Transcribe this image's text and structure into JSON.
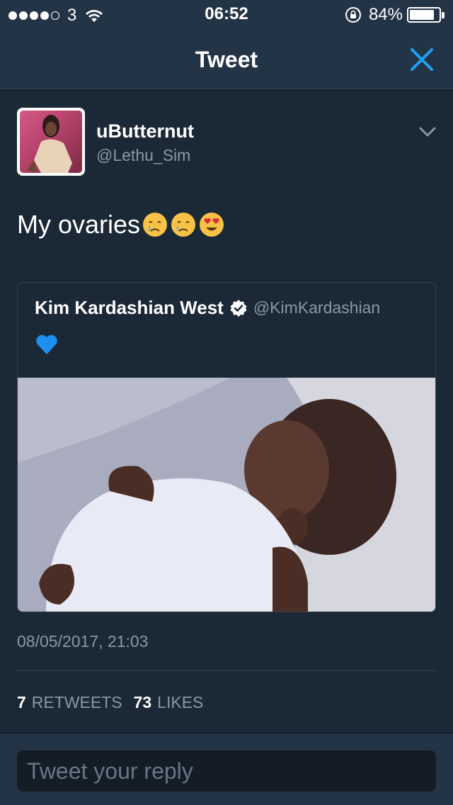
{
  "status_bar": {
    "carrier": "3",
    "time": "06:52",
    "battery_percent": "84%",
    "battery_level": 0.84,
    "signal_bars_filled": 4,
    "signal_bars_total": 5
  },
  "nav": {
    "title": "Tweet",
    "close_icon": "close-icon"
  },
  "tweet": {
    "author_name": "uButternut",
    "author_handle": "@Lethu_Sim",
    "text": "My ovaries",
    "emojis": [
      "crying-face",
      "crying-face",
      "heart-eyes-face"
    ],
    "timestamp": "08/05/2017, 21:03",
    "retweets_count": "7",
    "retweets_label": "RETWEETS",
    "likes_count": "73",
    "likes_label": "LIKES"
  },
  "quoted_tweet": {
    "author_name": "Kim Kardashian West",
    "author_handle": "@KimKardashian",
    "verified": true,
    "content_icon": "blue-heart-icon"
  },
  "reply": {
    "placeholder": "Tweet your reply"
  },
  "colors": {
    "background": "#1b2836",
    "bar": "#243447",
    "accent": "#1da1f2",
    "secondary_text": "#8899a6"
  }
}
